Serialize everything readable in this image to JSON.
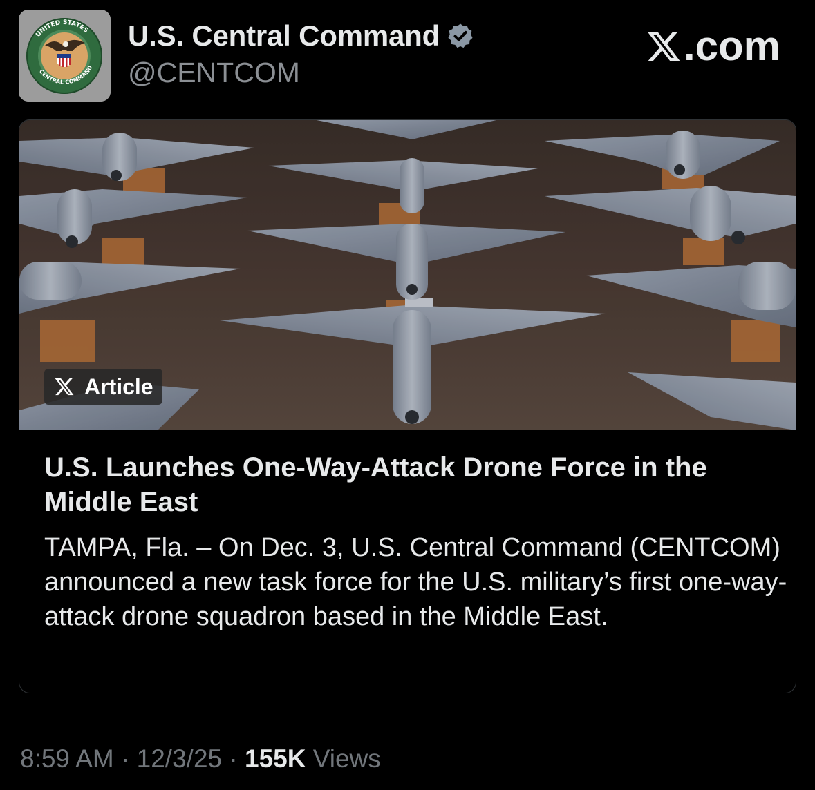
{
  "post": {
    "author_name": "U.S. Central Command",
    "handle": "@CENTCOM",
    "verified": true,
    "avatar": {
      "icon": "centcom-seal-icon",
      "ring_text_top": "UNITED STATES",
      "ring_text_bottom": "CENTRAL COMMAND"
    }
  },
  "brand": {
    "icon": "x-logo-icon",
    "text": ".com"
  },
  "article": {
    "badge_icon": "x-logo-icon",
    "badge_label": "Article",
    "image_subject": "rows of gray delta-wing drones",
    "title": "U.S. Launches One-Way-Attack Drone Force in the Middle East",
    "description": "TAMPA, Fla. – On Dec. 3, U.S. Central Command (CENTCOM) announced a new task force for the U.S. military’s first one-way-attack drone squadron based in the Middle East."
  },
  "meta": {
    "time": "8:59 AM",
    "separator": "·",
    "date": "12/3/25",
    "views_count": "155K",
    "views_label": "Views"
  },
  "colors": {
    "background": "#000000",
    "text_primary": "#e7e9ea",
    "text_secondary": "#71767b",
    "verified_badge": "#8b98a5",
    "card_border": "#2f3336"
  }
}
